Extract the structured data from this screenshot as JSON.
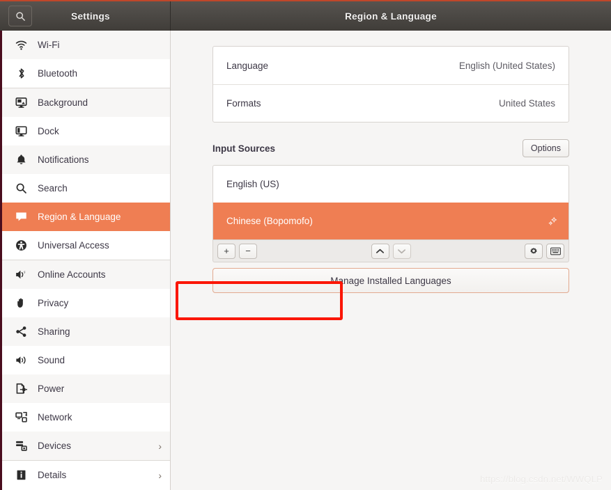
{
  "window": {
    "sidebar_title": "Settings",
    "page_title": "Region & Language",
    "search_icon": "search-icon"
  },
  "sidebar": {
    "items": [
      {
        "label": "Wi-Fi",
        "icon": "wifi-icon",
        "active": false,
        "chevron": "",
        "separator_after": false
      },
      {
        "label": "Bluetooth",
        "icon": "bluetooth-icon",
        "active": false,
        "chevron": "",
        "separator_after": true
      },
      {
        "label": "Background",
        "icon": "background-icon",
        "active": false,
        "chevron": "",
        "separator_after": false
      },
      {
        "label": "Dock",
        "icon": "dock-icon",
        "active": false,
        "chevron": "",
        "separator_after": false
      },
      {
        "label": "Notifications",
        "icon": "bell-icon",
        "active": false,
        "chevron": "",
        "separator_after": false
      },
      {
        "label": "Search",
        "icon": "search-icon",
        "active": false,
        "chevron": "",
        "separator_after": false
      },
      {
        "label": "Region & Language",
        "icon": "region-language-icon",
        "active": true,
        "chevron": "",
        "separator_after": false
      },
      {
        "label": "Universal Access",
        "icon": "accessibility-icon",
        "active": false,
        "chevron": "",
        "separator_after": true
      },
      {
        "label": "Online Accounts",
        "icon": "online-accounts-icon",
        "active": false,
        "chevron": "",
        "separator_after": false
      },
      {
        "label": "Privacy",
        "icon": "hand-icon",
        "active": false,
        "chevron": "",
        "separator_after": false
      },
      {
        "label": "Sharing",
        "icon": "share-icon",
        "active": false,
        "chevron": "",
        "separator_after": false
      },
      {
        "label": "Sound",
        "icon": "speaker-icon",
        "active": false,
        "chevron": "",
        "separator_after": false
      },
      {
        "label": "Power",
        "icon": "power-icon",
        "active": false,
        "chevron": "",
        "separator_after": false
      },
      {
        "label": "Network",
        "icon": "network-icon",
        "active": false,
        "chevron": "",
        "separator_after": false
      },
      {
        "label": "Devices",
        "icon": "devices-icon",
        "active": false,
        "chevron": "›",
        "separator_after": true
      },
      {
        "label": "Details",
        "icon": "details-icon",
        "active": false,
        "chevron": "›",
        "separator_after": false
      }
    ]
  },
  "main": {
    "language_card": [
      {
        "key": "Language",
        "value": "English (United States)"
      },
      {
        "key": "Formats",
        "value": "United States"
      }
    ],
    "input_sources": {
      "title": "Input Sources",
      "options_label": "Options",
      "rows": [
        {
          "label": "English (US)",
          "selected": false,
          "icon": ""
        },
        {
          "label": "Chinese (Bopomofo)",
          "selected": true,
          "icon": "preferences-icon"
        }
      ],
      "toolbar": {
        "add_label": "+",
        "remove_label": "−",
        "move_up_icon": "chevron-up-icon",
        "move_down_icon": "chevron-down-icon",
        "settings_icon": "gear-icon",
        "keyboard_icon": "keyboard-icon"
      }
    },
    "manage_languages_label": "Manage Installed Languages"
  },
  "annotation": {
    "color": "#fb1606",
    "target": "manage-installed-languages-button"
  },
  "watermark": {
    "text": "https://blog.csdn.net/WWQLP"
  },
  "colors": {
    "accent": "#ef7e53",
    "titlebar_top": "#57534f",
    "titlebar_accent_line": "#c0472a",
    "sidebar_edge": "#4a0d1e",
    "annotation": "#fb1606"
  }
}
